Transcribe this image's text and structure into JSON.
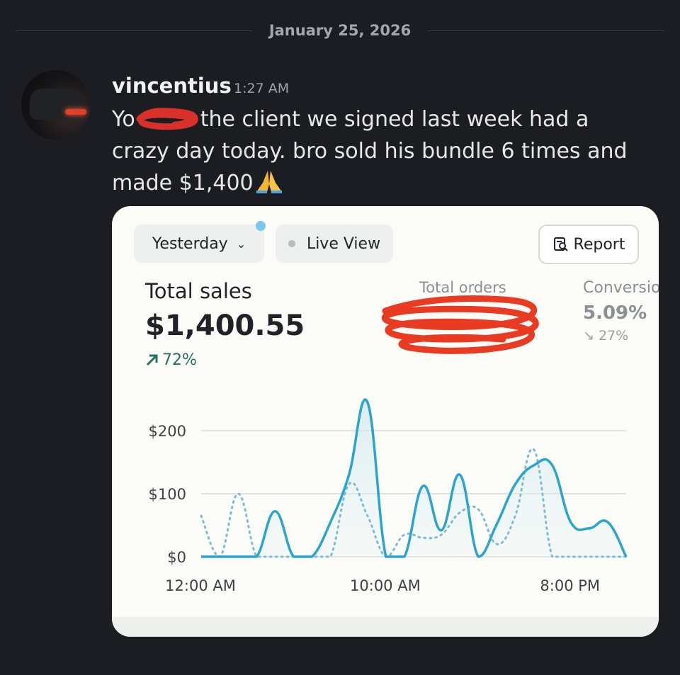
{
  "date_separator": "January 25, 2026",
  "author": {
    "name": "vincentius",
    "time": "1:27 AM"
  },
  "message": {
    "part1": "Yo",
    "part2": "the client we signed last week had a crazy day today. bro sold his bundle 6 times and made $1,400"
  },
  "card": {
    "period_label": "Yesterday",
    "live_view_label": "Live View",
    "report_label": "Report",
    "total_sales": {
      "label": "Total sales",
      "value": "$1,400.55",
      "change": "72%"
    },
    "total_orders": {
      "label": "Total orders"
    },
    "conversion": {
      "label": "Conversio",
      "value": "5.09%",
      "change": "27%"
    },
    "accent_color": "#2ba5cf",
    "positive_color": "#26705e"
  },
  "chart_data": {
    "type": "line",
    "y_ticks": [
      "$200",
      "$100",
      "$0"
    ],
    "x_ticks": [
      "12:00 AM",
      "10:00 AM",
      "8:00 PM"
    ],
    "ylim": [
      0,
      250
    ],
    "x_hours": [
      0,
      1,
      2,
      3,
      4,
      5,
      6,
      7,
      8,
      9,
      10,
      11,
      12,
      13,
      14,
      15,
      16,
      17,
      18,
      19,
      20,
      21,
      22,
      23
    ],
    "grid": true,
    "series": [
      {
        "style": "solid",
        "values": [
          0,
          0,
          0,
          0,
          72,
          0,
          0,
          55,
          130,
          245,
          0,
          0,
          112,
          42,
          130,
          0,
          52,
          115,
          145,
          145,
          55,
          45,
          55,
          0
        ]
      },
      {
        "style": "dotted",
        "values": [
          65,
          0,
          100,
          0,
          0,
          0,
          0,
          0,
          115,
          65,
          0,
          35,
          30,
          35,
          70,
          75,
          20,
          65,
          170,
          0,
          0,
          0,
          0,
          0
        ]
      }
    ]
  }
}
